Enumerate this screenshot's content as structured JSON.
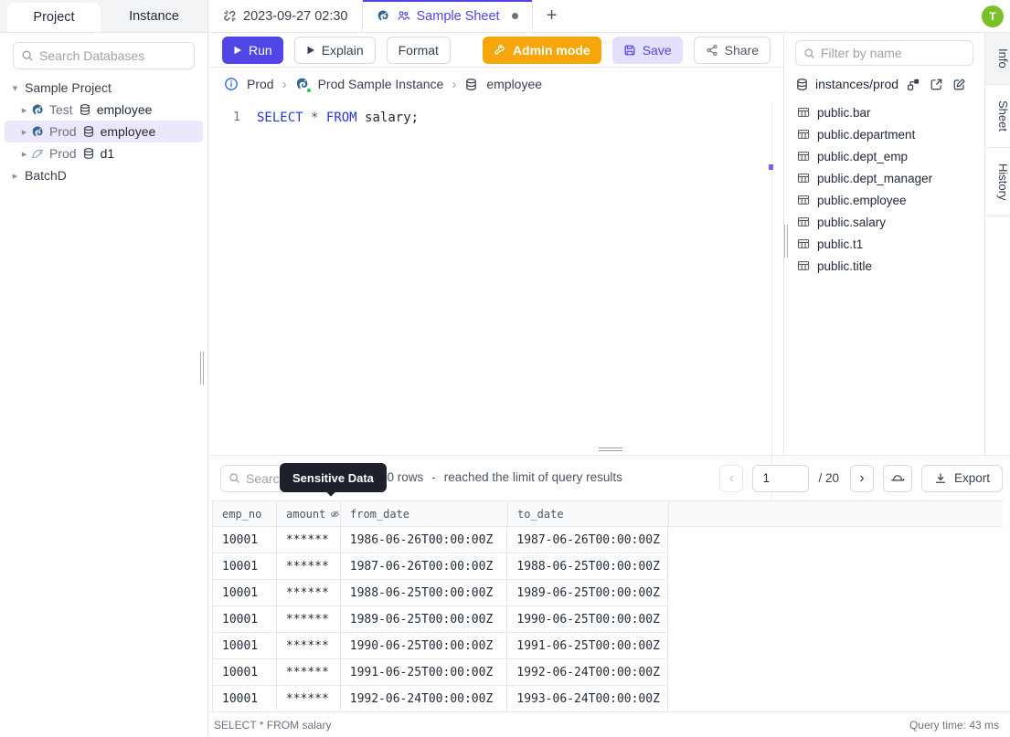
{
  "header": {
    "avatar_initial": "T",
    "sidebar_tabs": [
      {
        "label": "Project"
      },
      {
        "label": "Instance"
      }
    ],
    "editor_tabs": [
      {
        "label": "2023-09-27 02:30"
      },
      {
        "label": "Sample Sheet"
      }
    ],
    "new_tab_label": "+"
  },
  "icons": {
    "caret_down": "▾",
    "caret_right": "▸",
    "breadcrumb_sep": "›",
    "chevron_left": "‹",
    "chevron_right": "›"
  },
  "sidebar": {
    "search_placeholder": "Search Databases",
    "tree": [
      {
        "label": "Sample Project"
      },
      {
        "env": "Test",
        "db": "employee",
        "engine": "postgres"
      },
      {
        "env": "Prod",
        "db": "employee",
        "engine": "postgres",
        "selected": true
      },
      {
        "env": "Prod",
        "db": "d1",
        "engine": "mysql"
      },
      {
        "label": "BatchD"
      }
    ]
  },
  "toolbar": {
    "run_label": "Run",
    "explain_label": "Explain",
    "format_label": "Format",
    "admin_mode_label": "Admin mode",
    "save_label": "Save",
    "share_label": "Share"
  },
  "breadcrumb": {
    "environment": "Prod",
    "instance": "Prod Sample Instance",
    "database": "employee"
  },
  "editor": {
    "line_number": "1",
    "tokens": [
      {
        "text": "SELECT"
      },
      {
        "text": "*"
      },
      {
        "text": "FROM"
      },
      {
        "text": "salary;"
      }
    ]
  },
  "right_panel": {
    "filter_placeholder": "Filter by name",
    "connection_label": "instances/prod",
    "tables": [
      {
        "name": "public.bar"
      },
      {
        "name": "public.department"
      },
      {
        "name": "public.dept_emp"
      },
      {
        "name": "public.dept_manager"
      },
      {
        "name": "public.employee"
      },
      {
        "name": "public.salary"
      },
      {
        "name": "public.t1"
      },
      {
        "name": "public.title"
      }
    ],
    "side_tabs": [
      {
        "label": "Info"
      },
      {
        "label": "Sheet"
      },
      {
        "label": "History"
      }
    ]
  },
  "results": {
    "search_placeholder": "Search",
    "tooltip_label": "Sensitive Data",
    "rows_count": "1000 rows",
    "rows_sep": "-",
    "limit_note": "reached the limit of query results",
    "page_value": "1",
    "page_total": "/ 20",
    "export_label": "Export",
    "columns": [
      {
        "name": "emp_no"
      },
      {
        "name": "amount"
      },
      {
        "name": "from_date"
      },
      {
        "name": "to_date"
      }
    ],
    "rows": [
      [
        "10001",
        "******",
        "1986-06-26T00:00:00Z",
        "1987-06-26T00:00:00Z"
      ],
      [
        "10001",
        "******",
        "1987-06-26T00:00:00Z",
        "1988-06-25T00:00:00Z"
      ],
      [
        "10001",
        "******",
        "1988-06-25T00:00:00Z",
        "1989-06-25T00:00:00Z"
      ],
      [
        "10001",
        "******",
        "1989-06-25T00:00:00Z",
        "1990-06-25T00:00:00Z"
      ],
      [
        "10001",
        "******",
        "1990-06-25T00:00:00Z",
        "1991-06-25T00:00:00Z"
      ],
      [
        "10001",
        "******",
        "1991-06-25T00:00:00Z",
        "1992-06-24T00:00:00Z"
      ],
      [
        "10001",
        "******",
        "1992-06-24T00:00:00Z",
        "1993-06-24T00:00:00Z"
      ]
    ],
    "status_query": "SELECT * FROM salary",
    "status_time": "Query time: 43 ms"
  },
  "colors": {
    "accent": "#4f46e5",
    "admin_orange": "#f5a60b",
    "save_bg": "#e4e0fb",
    "avatar_green": "#7ac127",
    "green_dot": "#22c55e",
    "selected_row_bg": "#ebe8fb",
    "keyword_blue": "#2936d2",
    "tooltip_bg": "#1c212b",
    "border": "#e5e7eb"
  }
}
